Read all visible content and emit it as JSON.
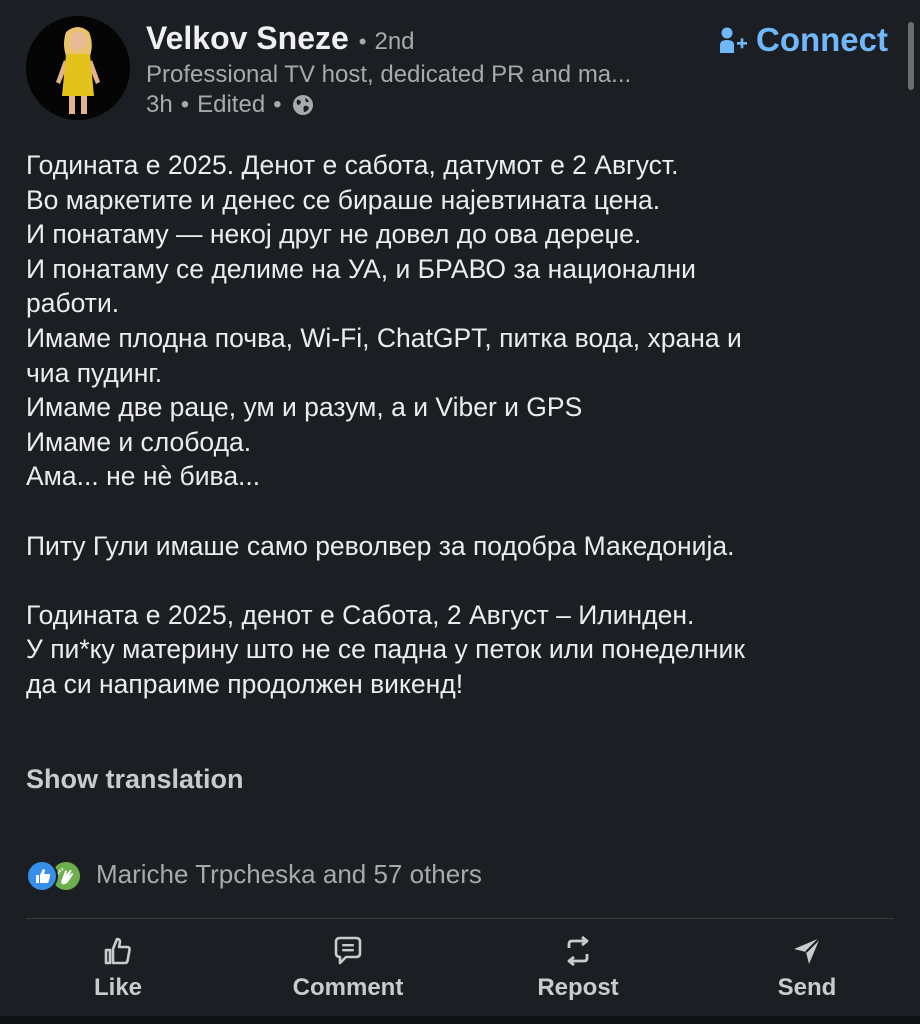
{
  "author": {
    "name": "Velkov Sneze",
    "degree_separator": "•",
    "degree": "2nd",
    "headline": "Professional TV host, dedicated PR and ma...",
    "time": "3h",
    "edited": "Edited",
    "meta_separator": "•",
    "visibility_icon": "globe-icon"
  },
  "connect": {
    "label": "Connect",
    "icon": "add-person-icon"
  },
  "post": {
    "lines": [
      "Годината е 2025. Денот е сабота, датумот е 2 Август.",
      "Во маркетите и денес се бираше најевтината цена.",
      "И понатаму — некој друг не довел до ова дереџе.",
      "И понатаму се делиме на УА, и БРАВО за национални",
      "работи.",
      "Имаме плодна почва, Wi-Fi, ChatGPT, питка вода, храна и",
      "чиа пудинг.",
      "Имаме две раце, ум и разум, а и Viber и GPS",
      "Имаме и слобода.",
      "Ама... не нѐ бива...",
      "",
      "Питу Гули имаше само револвер за подобра Македонија.",
      "",
      "Годината е 2025, денот е Сабота, 2 Август – Илинден.",
      "У пи*ку материну што не се падна у петок или понеделник",
      "да си напраиме продолжен викенд!"
    ]
  },
  "show_translation": "Show translation",
  "reactions": {
    "summary": "Mariche Trpcheska and 57 others",
    "icons": [
      "like-reaction-icon",
      "celebrate-reaction-icon"
    ]
  },
  "actions": {
    "like": "Like",
    "comment": "Comment",
    "repost": "Repost",
    "send": "Send"
  },
  "colors": {
    "background": "#1b1f23",
    "accent": "#71b7fb",
    "secondary_text": "#a7a9ab"
  }
}
